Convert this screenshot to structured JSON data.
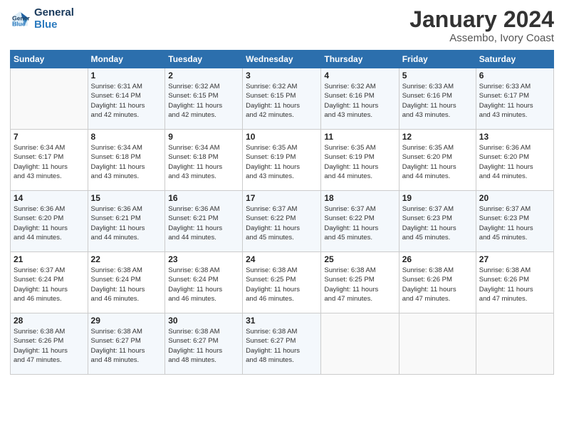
{
  "logo": {
    "text_general": "General",
    "text_blue": "Blue"
  },
  "header": {
    "month": "January 2024",
    "location": "Assembo, Ivory Coast"
  },
  "weekdays": [
    "Sunday",
    "Monday",
    "Tuesday",
    "Wednesday",
    "Thursday",
    "Friday",
    "Saturday"
  ],
  "weeks": [
    [
      {
        "day": "",
        "info": ""
      },
      {
        "day": "1",
        "info": "Sunrise: 6:31 AM\nSunset: 6:14 PM\nDaylight: 11 hours\nand 42 minutes."
      },
      {
        "day": "2",
        "info": "Sunrise: 6:32 AM\nSunset: 6:15 PM\nDaylight: 11 hours\nand 42 minutes."
      },
      {
        "day": "3",
        "info": "Sunrise: 6:32 AM\nSunset: 6:15 PM\nDaylight: 11 hours\nand 42 minutes."
      },
      {
        "day": "4",
        "info": "Sunrise: 6:32 AM\nSunset: 6:16 PM\nDaylight: 11 hours\nand 43 minutes."
      },
      {
        "day": "5",
        "info": "Sunrise: 6:33 AM\nSunset: 6:16 PM\nDaylight: 11 hours\nand 43 minutes."
      },
      {
        "day": "6",
        "info": "Sunrise: 6:33 AM\nSunset: 6:17 PM\nDaylight: 11 hours\nand 43 minutes."
      }
    ],
    [
      {
        "day": "7",
        "info": "Sunrise: 6:34 AM\nSunset: 6:17 PM\nDaylight: 11 hours\nand 43 minutes."
      },
      {
        "day": "8",
        "info": "Sunrise: 6:34 AM\nSunset: 6:18 PM\nDaylight: 11 hours\nand 43 minutes."
      },
      {
        "day": "9",
        "info": "Sunrise: 6:34 AM\nSunset: 6:18 PM\nDaylight: 11 hours\nand 43 minutes."
      },
      {
        "day": "10",
        "info": "Sunrise: 6:35 AM\nSunset: 6:19 PM\nDaylight: 11 hours\nand 43 minutes."
      },
      {
        "day": "11",
        "info": "Sunrise: 6:35 AM\nSunset: 6:19 PM\nDaylight: 11 hours\nand 44 minutes."
      },
      {
        "day": "12",
        "info": "Sunrise: 6:35 AM\nSunset: 6:20 PM\nDaylight: 11 hours\nand 44 minutes."
      },
      {
        "day": "13",
        "info": "Sunrise: 6:36 AM\nSunset: 6:20 PM\nDaylight: 11 hours\nand 44 minutes."
      }
    ],
    [
      {
        "day": "14",
        "info": "Sunrise: 6:36 AM\nSunset: 6:20 PM\nDaylight: 11 hours\nand 44 minutes."
      },
      {
        "day": "15",
        "info": "Sunrise: 6:36 AM\nSunset: 6:21 PM\nDaylight: 11 hours\nand 44 minutes."
      },
      {
        "day": "16",
        "info": "Sunrise: 6:36 AM\nSunset: 6:21 PM\nDaylight: 11 hours\nand 44 minutes."
      },
      {
        "day": "17",
        "info": "Sunrise: 6:37 AM\nSunset: 6:22 PM\nDaylight: 11 hours\nand 45 minutes."
      },
      {
        "day": "18",
        "info": "Sunrise: 6:37 AM\nSunset: 6:22 PM\nDaylight: 11 hours\nand 45 minutes."
      },
      {
        "day": "19",
        "info": "Sunrise: 6:37 AM\nSunset: 6:23 PM\nDaylight: 11 hours\nand 45 minutes."
      },
      {
        "day": "20",
        "info": "Sunrise: 6:37 AM\nSunset: 6:23 PM\nDaylight: 11 hours\nand 45 minutes."
      }
    ],
    [
      {
        "day": "21",
        "info": "Sunrise: 6:37 AM\nSunset: 6:24 PM\nDaylight: 11 hours\nand 46 minutes."
      },
      {
        "day": "22",
        "info": "Sunrise: 6:38 AM\nSunset: 6:24 PM\nDaylight: 11 hours\nand 46 minutes."
      },
      {
        "day": "23",
        "info": "Sunrise: 6:38 AM\nSunset: 6:24 PM\nDaylight: 11 hours\nand 46 minutes."
      },
      {
        "day": "24",
        "info": "Sunrise: 6:38 AM\nSunset: 6:25 PM\nDaylight: 11 hours\nand 46 minutes."
      },
      {
        "day": "25",
        "info": "Sunrise: 6:38 AM\nSunset: 6:25 PM\nDaylight: 11 hours\nand 47 minutes."
      },
      {
        "day": "26",
        "info": "Sunrise: 6:38 AM\nSunset: 6:26 PM\nDaylight: 11 hours\nand 47 minutes."
      },
      {
        "day": "27",
        "info": "Sunrise: 6:38 AM\nSunset: 6:26 PM\nDaylight: 11 hours\nand 47 minutes."
      }
    ],
    [
      {
        "day": "28",
        "info": "Sunrise: 6:38 AM\nSunset: 6:26 PM\nDaylight: 11 hours\nand 47 minutes."
      },
      {
        "day": "29",
        "info": "Sunrise: 6:38 AM\nSunset: 6:27 PM\nDaylight: 11 hours\nand 48 minutes."
      },
      {
        "day": "30",
        "info": "Sunrise: 6:38 AM\nSunset: 6:27 PM\nDaylight: 11 hours\nand 48 minutes."
      },
      {
        "day": "31",
        "info": "Sunrise: 6:38 AM\nSunset: 6:27 PM\nDaylight: 11 hours\nand 48 minutes."
      },
      {
        "day": "",
        "info": ""
      },
      {
        "day": "",
        "info": ""
      },
      {
        "day": "",
        "info": ""
      }
    ]
  ]
}
